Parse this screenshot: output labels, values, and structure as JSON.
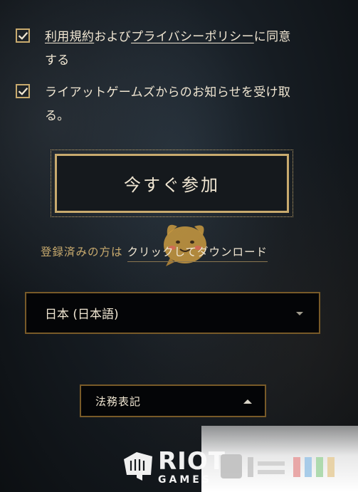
{
  "consent": {
    "terms": {
      "checked": true,
      "link1": "利用規約",
      "mid": "および",
      "link2": "プライバシーポリシー",
      "tail1": "に同意",
      "tail2": "する"
    },
    "news": {
      "checked": true,
      "line1": "ライアットゲームズからのお知らせを受け取",
      "line2": "る。"
    }
  },
  "join_button": {
    "label": "今すぐ参加"
  },
  "registered": {
    "prefix": "登録済みの方は",
    "link": "クリックしてダウンロード"
  },
  "language_select": {
    "value": "日本 (日本語)"
  },
  "legal_dropdown": {
    "label": "法務表記"
  },
  "logo": {
    "line1": "RIOT",
    "line2": "GAMES"
  },
  "colors": {
    "gold": "#c8aa6e",
    "gold_dark": "#785a28",
    "text": "#f0e6d2",
    "field_bg": "#040507"
  },
  "icons": {
    "checkbox": "checkmark-icon",
    "select": "caret-down-icon",
    "legal": "caret-up-icon",
    "logo": "riot-fist-icon",
    "mascot": "mascot-icon"
  }
}
